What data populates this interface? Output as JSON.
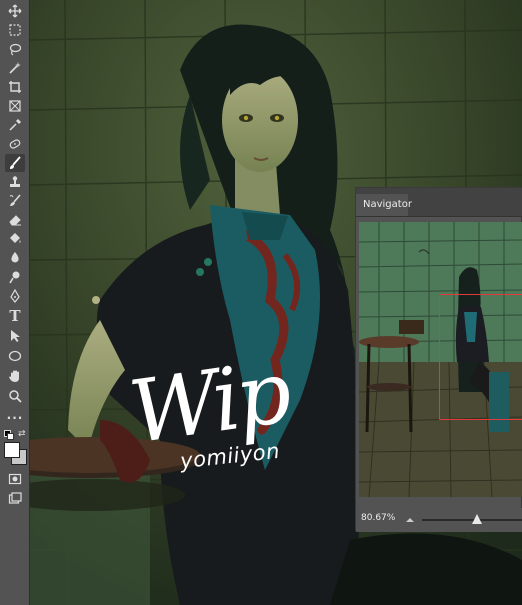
{
  "toolbar": {
    "tools": [
      {
        "name": "move-tool",
        "icon": "move-icon"
      },
      {
        "name": "marquee-tool",
        "icon": "rect-marquee-icon"
      },
      {
        "name": "lasso-tool",
        "icon": "lasso-icon"
      },
      {
        "name": "magic-wand-tool",
        "icon": "magic-wand-icon"
      },
      {
        "name": "crop-tool",
        "icon": "crop-icon"
      },
      {
        "name": "frame-tool",
        "icon": "frame-icon"
      },
      {
        "name": "eyedropper-tool",
        "icon": "eyedropper-icon"
      },
      {
        "name": "healing-brush-tool",
        "icon": "healing-brush-icon"
      },
      {
        "name": "brush-tool",
        "icon": "brush-icon",
        "active": true
      },
      {
        "name": "clone-stamp-tool",
        "icon": "clone-stamp-icon"
      },
      {
        "name": "history-brush-tool",
        "icon": "history-brush-icon"
      },
      {
        "name": "eraser-tool",
        "icon": "eraser-icon"
      },
      {
        "name": "paint-bucket-tool",
        "icon": "paint-bucket-icon"
      },
      {
        "name": "blur-tool",
        "icon": "blur-icon"
      },
      {
        "name": "dodge-tool",
        "icon": "dodge-icon"
      },
      {
        "name": "pen-tool",
        "icon": "pen-icon"
      },
      {
        "name": "type-tool",
        "icon": "type-icon",
        "label": "T"
      },
      {
        "name": "path-selection-tool",
        "icon": "path-selection-icon"
      },
      {
        "name": "ellipse-tool",
        "icon": "ellipse-icon"
      },
      {
        "name": "hand-tool",
        "icon": "hand-icon"
      },
      {
        "name": "zoom-tool",
        "icon": "zoom-icon"
      },
      {
        "name": "more-tools",
        "icon": "more-icon",
        "label": "..."
      }
    ],
    "foreground_color": "#ffffff",
    "background_color": "#c8c8c8"
  },
  "canvas": {
    "watermark_title": "Wip",
    "watermark_signature": "yomiiyon",
    "scene_colors": {
      "wall": "#3f4f2f",
      "dress": "#1b1d22",
      "panel": "#1f6c77",
      "hair": "#17221e",
      "skin": "#c8c78c"
    }
  },
  "navigator": {
    "title": "Navigator",
    "zoom": "80.67%",
    "zoom_slider_fraction": 0.55,
    "frame_color": "#e3393c"
  }
}
